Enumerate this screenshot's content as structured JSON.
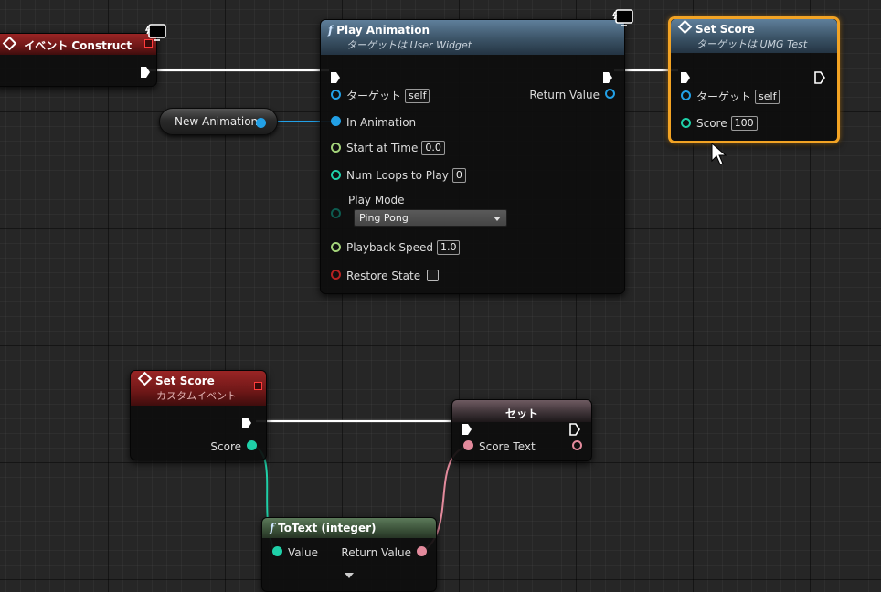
{
  "colors": {
    "exec": "#ffffff",
    "object_pin": "#22a0e6",
    "float_pin": "#a3d37a",
    "int_pin": "#1fd0a8",
    "bool_pin": "#b52222",
    "byte_pin": "#0d5b4f",
    "text_pin": "#e38a9c",
    "selection": "#f2a324"
  },
  "event_construct": {
    "title": "イベント Construct",
    "icon": "diamond-event-icon"
  },
  "new_animation": {
    "label": "New Animation"
  },
  "play_animation": {
    "title": "Play Animation",
    "subtitle": "ターゲットは User Widget",
    "icon": "function-icon",
    "pins": {
      "target": {
        "label": "ターゲット",
        "value": "self"
      },
      "in_animation": {
        "label": "In Animation"
      },
      "start_at_time": {
        "label": "Start at Time",
        "value": "0.0"
      },
      "num_loops": {
        "label": "Num Loops to Play",
        "value": "0"
      },
      "play_mode": {
        "label": "Play Mode",
        "value": "Ping Pong"
      },
      "playback_speed": {
        "label": "Playback Speed",
        "value": "1.0"
      },
      "restore_state": {
        "label": "Restore State"
      },
      "return_value": {
        "label": "Return Value"
      }
    }
  },
  "set_score_call": {
    "title": "Set Score",
    "subtitle": "ターゲットは UMG Test",
    "icon": "diamond-event-icon",
    "pins": {
      "target": {
        "label": "ターゲット",
        "value": "self"
      },
      "score": {
        "label": "Score",
        "value": "100"
      }
    }
  },
  "set_score_event": {
    "title": "Set Score",
    "subtitle": "カスタムイベント",
    "icon": "diamond-event-icon",
    "pins": {
      "score": {
        "label": "Score"
      }
    }
  },
  "set_node": {
    "title": "セット",
    "pins": {
      "score_text": {
        "label": "Score Text"
      }
    }
  },
  "to_text": {
    "title": "ToText (integer)",
    "icon": "function-icon",
    "pins": {
      "value": {
        "label": "Value"
      },
      "return_value": {
        "label": "Return Value"
      }
    }
  }
}
